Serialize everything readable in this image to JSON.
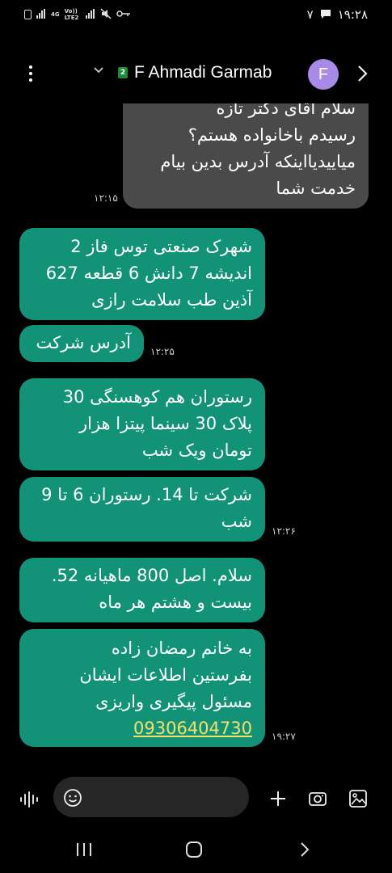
{
  "status_bar": {
    "time": "۱۹:۲۸",
    "network_label": "4G",
    "network_label2": "Vo)) LTE2",
    "sim_count": "۷"
  },
  "header": {
    "contact_name": "F Ahmadi Garmab",
    "avatar_letter": "F",
    "sim_badge": "2"
  },
  "messages": [
    {
      "type": "incoming",
      "lines": [
        "سلام آقای دکتر تازه",
        "رسیدم باخانواده هستم؟",
        "میاییدیااینکه آدرس بدین بیام",
        "خدمت شما"
      ],
      "time": "۱۲:۱۵"
    },
    {
      "type": "outgoing",
      "lines": [
        "شهرک صنعتی توس فاز 2",
        "اندیشه 7 دانش 6 قطعه 627",
        "آذین طب سلامت رازی"
      ],
      "time": ""
    },
    {
      "type": "outgoing",
      "lines": [
        "آدرس شرکت"
      ],
      "time": "۱۲:۲۵"
    },
    {
      "type": "outgoing",
      "lines": [
        "رستوران هم کوهسنگی 30",
        "پلاک 30 سینما پیتزا هزار",
        "تومان ویک شب"
      ],
      "time": ""
    },
    {
      "type": "outgoing",
      "lines": [
        "شرکت تا 14. رستوران 6 تا 9",
        "شب"
      ],
      "time": "۱۲:۲۶"
    },
    {
      "type": "outgoing",
      "lines": [
        "سلام. اصل 800 ماهیانه 52.",
        "بیست و هشتم هر ماه"
      ],
      "time": ""
    },
    {
      "type": "outgoing",
      "lines": [
        "به خانم رمضان زاده",
        "بفرستین اطلاعات ایشان",
        "مسئول پیگیری واریزی"
      ],
      "phone": "09306404730",
      "time": "۱۹:۲۷"
    }
  ],
  "composer": {
    "placeholder": ""
  },
  "colors": {
    "incoming_bubble": "#4a4a4a",
    "outgoing_bubble": "#129377",
    "avatar": "#a98ae8",
    "link": "#f3e16a"
  }
}
